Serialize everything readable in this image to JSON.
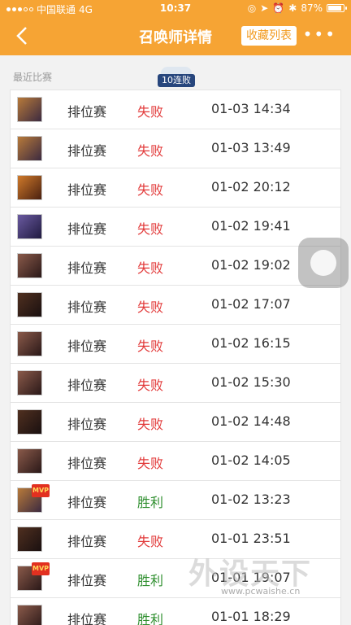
{
  "status_bar": {
    "carrier": "中国联通",
    "network": "4G",
    "time": "10:37",
    "battery": "87%"
  },
  "nav": {
    "back_icon": "chevron-left-icon",
    "title": "召唤师详情",
    "favorite_label": "收藏列表",
    "more_icon": "more-dots-icon"
  },
  "section": {
    "label": "最近比赛",
    "streak_badge": "10连败"
  },
  "colors": {
    "brand": "#f6a434",
    "lose": "#e23a3a",
    "win": "#2f8f2f"
  },
  "matches": [
    {
      "mode": "排位赛",
      "result": "失败",
      "datetime": "01-03 14:34",
      "mvp": false
    },
    {
      "mode": "排位赛",
      "result": "失败",
      "datetime": "01-03 13:49",
      "mvp": false
    },
    {
      "mode": "排位赛",
      "result": "失败",
      "datetime": "01-02 20:12",
      "mvp": false
    },
    {
      "mode": "排位赛",
      "result": "失败",
      "datetime": "01-02 19:41",
      "mvp": false
    },
    {
      "mode": "排位赛",
      "result": "失败",
      "datetime": "01-02 19:02",
      "mvp": false
    },
    {
      "mode": "排位赛",
      "result": "失败",
      "datetime": "01-02 17:07",
      "mvp": false
    },
    {
      "mode": "排位赛",
      "result": "失败",
      "datetime": "01-02 16:15",
      "mvp": false
    },
    {
      "mode": "排位赛",
      "result": "失败",
      "datetime": "01-02 15:30",
      "mvp": false
    },
    {
      "mode": "排位赛",
      "result": "失败",
      "datetime": "01-02 14:48",
      "mvp": false
    },
    {
      "mode": "排位赛",
      "result": "失败",
      "datetime": "01-02 14:05",
      "mvp": false
    },
    {
      "mode": "排位赛",
      "result": "胜利",
      "datetime": "01-02 13:23",
      "mvp": true,
      "mvp_label": "MVP"
    },
    {
      "mode": "排位赛",
      "result": "失败",
      "datetime": "01-01 23:51",
      "mvp": false
    },
    {
      "mode": "排位赛",
      "result": "胜利",
      "datetime": "01-01 19:07",
      "mvp": true,
      "mvp_label": "MVP"
    },
    {
      "mode": "排位赛",
      "result": "胜利",
      "datetime": "01-01 18:29",
      "mvp": false
    }
  ],
  "watermark": {
    "text": "外设天下",
    "url": "www.pcwaishe.cn"
  }
}
